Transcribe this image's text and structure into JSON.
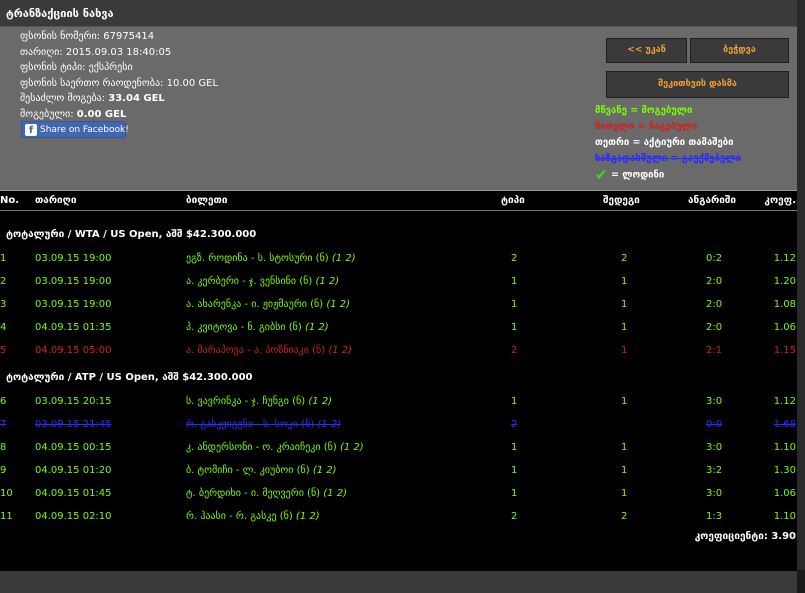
{
  "title": "ტრანზაქციის ნახვა",
  "info": {
    "lines": [
      {
        "label": "ფსონის ნომერი:",
        "value": "67975414",
        "bold": false
      },
      {
        "label": "თარიღი:",
        "value": "2015.09.03 18:40:05",
        "bold": false
      },
      {
        "label": "ფსონის ტიპი:",
        "value": "ექსპრესი",
        "bold": false
      },
      {
        "label": "ფსონის საერთო რაოდენობა:",
        "value": "10.00 GEL",
        "bold": false
      },
      {
        "label": "შესაძლო მოგება:",
        "value": "33.04 GEL",
        "bold": true
      },
      {
        "label": "მოგებული:",
        "value": "0.00 GEL",
        "bold": true
      }
    ],
    "facebook_label": "Share on Facebook!"
  },
  "buttons": {
    "back": "<< უკან",
    "print": "ბეჭდვა",
    "check": "შეკითხვის დასმა"
  },
  "legend": {
    "green": "მწვანე = მოგებული",
    "red": "წითელი = წაგებული",
    "white": "თეთრი = აქტიური თამაშები",
    "blue": "ხაზგადასმული = გაუქმებული",
    "check": "= ლოდინი"
  },
  "table": {
    "headers": {
      "no": "No.",
      "date": "თარიღი",
      "match": "ბილეთი",
      "type": "ტიპი",
      "pick": "შედეგი",
      "score": "ანგარიში",
      "odd": "კოეფ."
    },
    "groups": [
      {
        "title": "ტოტალური / WTA / US Open, აშშ $42.300.000",
        "rows": [
          {
            "no": "1",
            "date": "03.09.15 19:00",
            "match": "ეგზ. როდინა - ს. სტოსური (ნ)",
            "bet": "(1 2)",
            "type": "2",
            "pick": "2",
            "score": "0:2",
            "odd": "1.12",
            "status": "won"
          },
          {
            "no": "2",
            "date": "03.09.15 19:00",
            "match": "ა. კერბერი - ჯ. ვენსინი (ნ)",
            "bet": "(1 2)",
            "type": "1",
            "pick": "1",
            "score": "2:0",
            "odd": "1.20",
            "status": "won"
          },
          {
            "no": "3",
            "date": "03.09.15 19:00",
            "match": "ა. ახარენკა - ი. ჟიჟმაური (ნ)",
            "bet": "(1 2)",
            "type": "1",
            "pick": "1",
            "score": "2:0",
            "odd": "1.08",
            "status": "won"
          },
          {
            "no": "4",
            "date": "04.09.15 01:35",
            "match": "პ. კვიტოვა - ნ. გიბსი (ნ)",
            "bet": "(1 2)",
            "type": "1",
            "pick": "1",
            "score": "2:0",
            "odd": "1.06",
            "status": "won"
          },
          {
            "no": "5",
            "date": "04.09.15 05:00",
            "match": "ა. შარაპოვა - ა. პოზნიაკი (ნ)",
            "bet": "(1 2)",
            "type": "2",
            "pick": "1",
            "score": "2:1",
            "odd": "1.15",
            "status": "lost"
          }
        ]
      },
      {
        "title": "ტოტალური / ATP / US Open, აშშ $42.300.000",
        "rows": [
          {
            "no": "6",
            "date": "03.09.15 20:15",
            "match": "ს. ვავრინკა - ჯ. ჩუნგი (ნ)",
            "bet": "(1 2)",
            "type": "1",
            "pick": "1",
            "score": "3:0",
            "odd": "1.12",
            "status": "won"
          },
          {
            "no": "7",
            "date": "03.09.15 21:45",
            "match": "რ. გასკეიგენი - ს. სოკი (ნ)",
            "bet": "(1 2)",
            "type": "2",
            "pick": "",
            "score": "0:0",
            "odd": "1.68",
            "status": "returned"
          },
          {
            "no": "8",
            "date": "04.09.15 00:15",
            "match": "კ. ანდერსონი - ო. კრაიჩეკი (ნ)",
            "bet": "(1 2)",
            "type": "1",
            "pick": "1",
            "score": "3:0",
            "odd": "1.10",
            "status": "won"
          },
          {
            "no": "9",
            "date": "04.09.15 01:20",
            "match": "ბ. ტომიჩი - ლ. კიუბოი (ნ)",
            "bet": "(1 2)",
            "type": "1",
            "pick": "1",
            "score": "3:2",
            "odd": "1.30",
            "status": "won"
          },
          {
            "no": "10",
            "date": "04.09.15 01:45",
            "match": "ტ. ბერდიხი - ი. მეღვერი (ნ)",
            "bet": "(1 2)",
            "type": "1",
            "pick": "1",
            "score": "3:0",
            "odd": "1.06",
            "status": "won"
          },
          {
            "no": "11",
            "date": "04.09.15 02:10",
            "match": "რ. ჰაასი - რ. გასკე (ნ)",
            "bet": "(1 2)",
            "type": "2",
            "pick": "2",
            "score": "1:3",
            "odd": "1.10",
            "status": "won"
          }
        ]
      }
    ],
    "total": "კოეფიციენტი: 3.90"
  }
}
